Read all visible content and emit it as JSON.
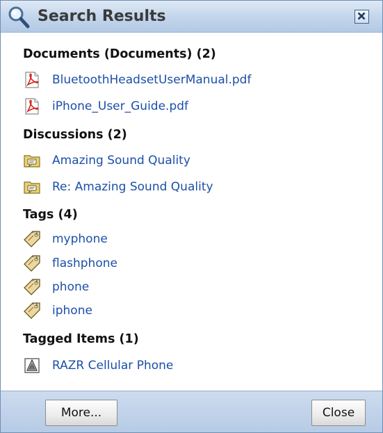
{
  "window": {
    "title": "Search Results",
    "close_tooltip": "Close"
  },
  "sections": {
    "documents": {
      "header": "Documents (Documents) (2)",
      "items": [
        "BluetoothHeadsetUserManual.pdf",
        "iPhone_User_Guide.pdf"
      ]
    },
    "discussions": {
      "header": "Discussions (2)",
      "items": [
        "Amazing Sound Quality",
        "Re: Amazing Sound Quality"
      ]
    },
    "tags": {
      "header": "Tags (4)",
      "items": [
        "myphone",
        "flashphone",
        "phone",
        "iphone"
      ]
    },
    "tagged_items": {
      "header": "Tagged Items (1)",
      "items": [
        "RAZR Cellular Phone"
      ]
    }
  },
  "footer": {
    "more_label": "More...",
    "close_label": "Close"
  },
  "colors": {
    "link": "#1b4fa8",
    "titlebar": "#c4d6ec",
    "footer": "#b6cbe6",
    "border": "#6f8fb3"
  },
  "icons": {
    "title": "search-icon",
    "document": "pdf-icon",
    "discussion": "discussion-folder-icon",
    "tag": "tag-icon",
    "tagged_item": "tagged-item-icon",
    "close": "close-icon"
  }
}
